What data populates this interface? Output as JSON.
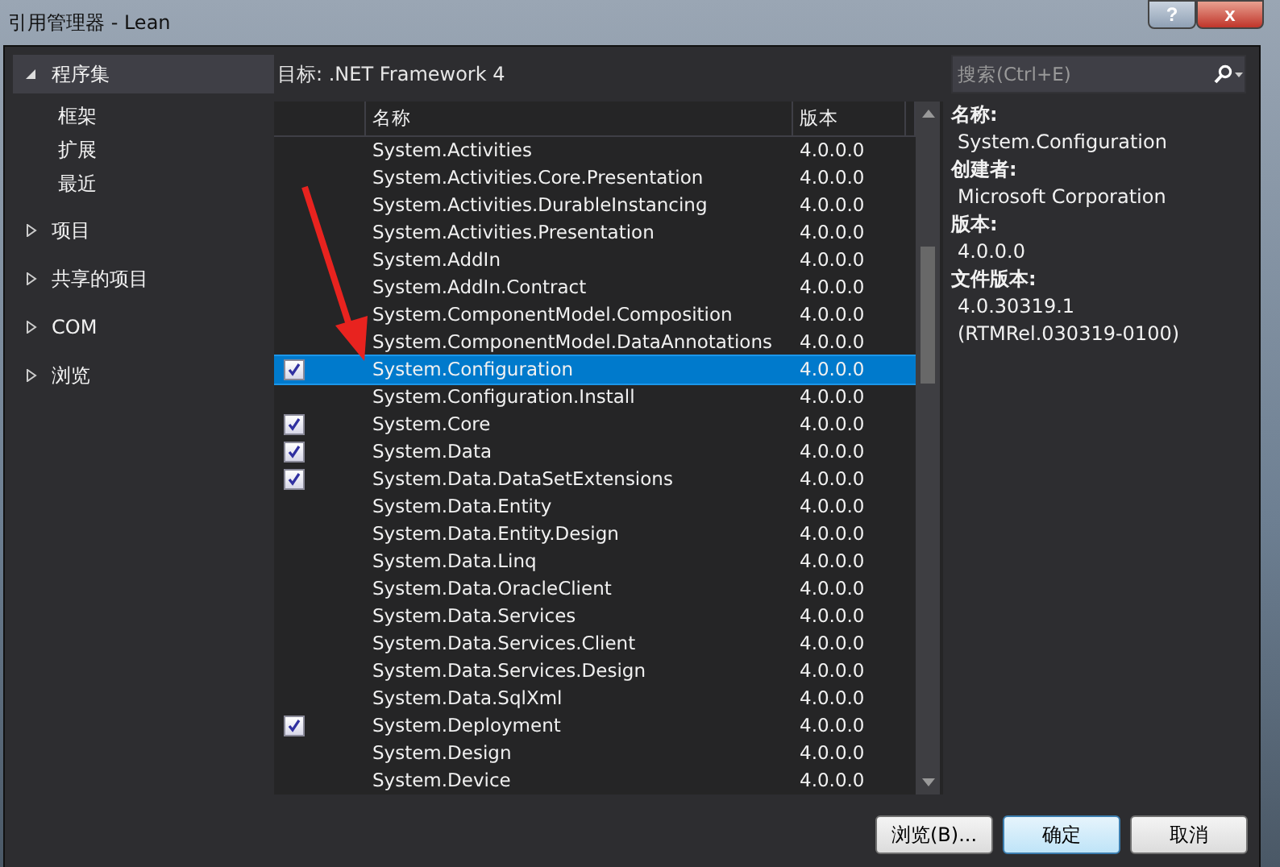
{
  "window": {
    "title": "引用管理器 - Lean",
    "help": "?",
    "close": "x"
  },
  "sidebar": {
    "items": [
      {
        "label": "程序集",
        "expanded": true,
        "selected": true,
        "children": [
          {
            "label": "框架"
          },
          {
            "label": "扩展"
          },
          {
            "label": "最近"
          }
        ]
      },
      {
        "label": "项目",
        "expanded": false,
        "selected": false
      },
      {
        "label": "共享的项目",
        "expanded": false,
        "selected": false
      },
      {
        "label": "COM",
        "expanded": false,
        "selected": false
      },
      {
        "label": "浏览",
        "expanded": false,
        "selected": false
      }
    ]
  },
  "target": "目标: .NET Framework 4",
  "search": {
    "placeholder": "搜索(Ctrl+E)"
  },
  "table": {
    "columns": [
      "名称",
      "版本"
    ],
    "rows": [
      {
        "name": "System.Activities",
        "version": "4.0.0.0",
        "checked": false,
        "selected": false
      },
      {
        "name": "System.Activities.Core.Presentation",
        "version": "4.0.0.0",
        "checked": false,
        "selected": false
      },
      {
        "name": "System.Activities.DurableInstancing",
        "version": "4.0.0.0",
        "checked": false,
        "selected": false
      },
      {
        "name": "System.Activities.Presentation",
        "version": "4.0.0.0",
        "checked": false,
        "selected": false
      },
      {
        "name": "System.AddIn",
        "version": "4.0.0.0",
        "checked": false,
        "selected": false
      },
      {
        "name": "System.AddIn.Contract",
        "version": "4.0.0.0",
        "checked": false,
        "selected": false
      },
      {
        "name": "System.ComponentModel.Composition",
        "version": "4.0.0.0",
        "checked": false,
        "selected": false
      },
      {
        "name": "System.ComponentModel.DataAnnotations",
        "version": "4.0.0.0",
        "checked": false,
        "selected": false
      },
      {
        "name": "System.Configuration",
        "version": "4.0.0.0",
        "checked": true,
        "selected": true
      },
      {
        "name": "System.Configuration.Install",
        "version": "4.0.0.0",
        "checked": false,
        "selected": false
      },
      {
        "name": "System.Core",
        "version": "4.0.0.0",
        "checked": true,
        "selected": false
      },
      {
        "name": "System.Data",
        "version": "4.0.0.0",
        "checked": true,
        "selected": false
      },
      {
        "name": "System.Data.DataSetExtensions",
        "version": "4.0.0.0",
        "checked": true,
        "selected": false
      },
      {
        "name": "System.Data.Entity",
        "version": "4.0.0.0",
        "checked": false,
        "selected": false
      },
      {
        "name": "System.Data.Entity.Design",
        "version": "4.0.0.0",
        "checked": false,
        "selected": false
      },
      {
        "name": "System.Data.Linq",
        "version": "4.0.0.0",
        "checked": false,
        "selected": false
      },
      {
        "name": "System.Data.OracleClient",
        "version": "4.0.0.0",
        "checked": false,
        "selected": false
      },
      {
        "name": "System.Data.Services",
        "version": "4.0.0.0",
        "checked": false,
        "selected": false
      },
      {
        "name": "System.Data.Services.Client",
        "version": "4.0.0.0",
        "checked": false,
        "selected": false
      },
      {
        "name": "System.Data.Services.Design",
        "version": "4.0.0.0",
        "checked": false,
        "selected": false
      },
      {
        "name": "System.Data.SqlXml",
        "version": "4.0.0.0",
        "checked": false,
        "selected": false
      },
      {
        "name": "System.Deployment",
        "version": "4.0.0.0",
        "checked": true,
        "selected": false
      },
      {
        "name": "System.Design",
        "version": "4.0.0.0",
        "checked": false,
        "selected": false
      },
      {
        "name": "System.Device",
        "version": "4.0.0.0",
        "checked": false,
        "selected": false
      }
    ]
  },
  "details": [
    {
      "label": "名称:",
      "value": [
        "System.Configuration"
      ]
    },
    {
      "label": "创建者:",
      "value": [
        "Microsoft Corporation"
      ]
    },
    {
      "label": "版本:",
      "value": [
        "4.0.0.0"
      ]
    },
    {
      "label": "文件版本:",
      "value": [
        "4.0.30319.1",
        "(RTMRel.030319-0100)"
      ]
    }
  ],
  "buttons": [
    {
      "label": "浏览(B)...",
      "default": false
    },
    {
      "label": "确定",
      "default": true
    },
    {
      "label": "取消",
      "default": false
    }
  ]
}
